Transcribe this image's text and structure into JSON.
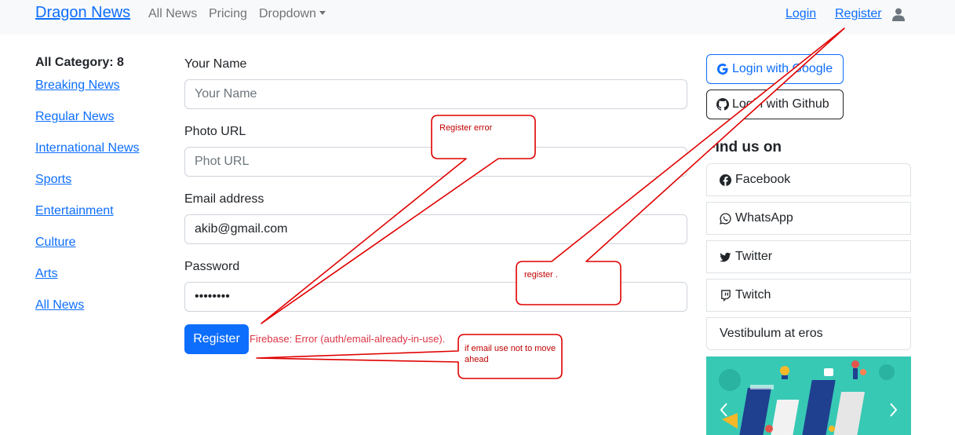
{
  "navbar": {
    "brand": "Dragon News",
    "links": [
      "All News",
      "Pricing",
      "Dropdown"
    ],
    "login": "Login",
    "register": "Register",
    "user_icon": "user-icon"
  },
  "sidebar": {
    "title": "All Category: 8",
    "categories": [
      "Breaking News",
      "Regular News",
      "International News",
      "Sports",
      "Entertainment",
      "Culture",
      "Arts",
      "All News"
    ]
  },
  "form": {
    "name_label": "Your Name",
    "name_placeholder": "Your Name",
    "photo_label": "Photo URL",
    "photo_placeholder": "Phot URL",
    "email_label": "Email address",
    "email_value": "akib@gmail.com",
    "password_label": "Password",
    "password_value": "••••••••",
    "submit_label": "Register",
    "error": "Firebase: Error (auth/email-already-in-use)."
  },
  "right": {
    "google_label": "Login with Google",
    "github_label": "Login with Github",
    "find_title": "Find us on",
    "socials": [
      {
        "label": "Facebook",
        "icon": "facebook-icon"
      },
      {
        "label": "WhatsApp",
        "icon": "whatsapp-icon"
      },
      {
        "label": "Twitter",
        "icon": "twitter-icon"
      },
      {
        "label": "Twitch",
        "icon": "twitch-icon"
      },
      {
        "label": "Vestibulum at eros",
        "icon": ""
      }
    ]
  },
  "annotations": {
    "register_error": "Register error",
    "register": "register .",
    "email_note": "if email use not to move ahead"
  },
  "colors": {
    "primary": "#0d6efd",
    "danger": "#dc3545",
    "navbar_bg": "#f8f9fa",
    "annotation": "#e00000"
  }
}
